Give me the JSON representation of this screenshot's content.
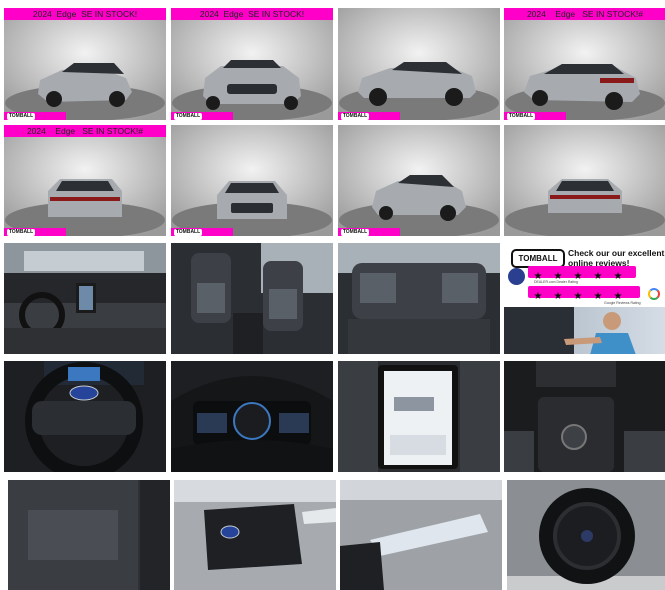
{
  "gallery": {
    "title_banner_1": "2024  Edge  SE IN STOCK!",
    "title_banner_2": "2024  Edge  SE IN STOCK!",
    "title_banner_3": "2024    Edge   SE IN STOCK!#",
    "title_banner_4": "2024    Edge   SE IN STOCK!#",
    "dealer_logo": "TOMBALL",
    "colors": {
      "accent": "#ff00c8",
      "vehicle": "#9ea2a6",
      "interior": "#2b2e33"
    }
  },
  "promo": {
    "logo": "TOMBALL",
    "headline": "Check our our excellent online reviews!",
    "stars_top": [
      "★",
      "★",
      "★",
      "★",
      "★"
    ],
    "stars_bottom": [
      "★",
      "★",
      "★",
      "★",
      "★"
    ],
    "source_top": "DEALER.com Dealer Rating",
    "source_bottom": "Google Reviews Rating"
  }
}
